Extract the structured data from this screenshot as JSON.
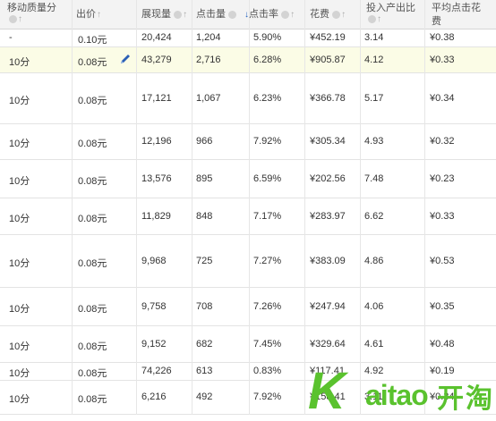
{
  "headers": {
    "quality": "移动质量分",
    "bid": "出价",
    "impressions": "展现量",
    "clicks": "点击量",
    "ctr": "点击率",
    "cost": "花费",
    "roi": "投入产出比",
    "avg_cpc_line1": "平均点击花",
    "avg_cpc_line2": "费"
  },
  "sort_indicators": {
    "up": "↑",
    "down": "↓",
    "active_column": "ctr"
  },
  "rows": [
    {
      "quality": "-",
      "bid": "0.10元",
      "impressions": "20,424",
      "clicks": "1,204",
      "ctr": "5.90%",
      "cost": "¥452.19",
      "roi": "3.14",
      "avg_cpc": "¥0.38"
    },
    {
      "quality": "10分",
      "bid": "0.08元",
      "impressions": "43,279",
      "clicks": "2,716",
      "ctr": "6.28%",
      "cost": "¥905.87",
      "roi": "4.12",
      "avg_cpc": "¥0.33"
    },
    {
      "quality": "10分",
      "bid": "0.08元",
      "impressions": "17,121",
      "clicks": "1,067",
      "ctr": "6.23%",
      "cost": "¥366.78",
      "roi": "5.17",
      "avg_cpc": "¥0.34"
    },
    {
      "quality": "10分",
      "bid": "0.08元",
      "impressions": "12,196",
      "clicks": "966",
      "ctr": "7.92%",
      "cost": "¥305.34",
      "roi": "4.93",
      "avg_cpc": "¥0.32"
    },
    {
      "quality": "10分",
      "bid": "0.08元",
      "impressions": "13,576",
      "clicks": "895",
      "ctr": "6.59%",
      "cost": "¥202.56",
      "roi": "7.48",
      "avg_cpc": "¥0.23"
    },
    {
      "quality": "10分",
      "bid": "0.08元",
      "impressions": "11,829",
      "clicks": "848",
      "ctr": "7.17%",
      "cost": "¥283.97",
      "roi": "6.62",
      "avg_cpc": "¥0.33"
    },
    {
      "quality": "10分",
      "bid": "0.08元",
      "impressions": "9,968",
      "clicks": "725",
      "ctr": "7.27%",
      "cost": "¥383.09",
      "roi": "4.86",
      "avg_cpc": "¥0.53"
    },
    {
      "quality": "10分",
      "bid": "0.08元",
      "impressions": "9,758",
      "clicks": "708",
      "ctr": "7.26%",
      "cost": "¥247.94",
      "roi": "4.06",
      "avg_cpc": "¥0.35"
    },
    {
      "quality": "10分",
      "bid": "0.08元",
      "impressions": "9,152",
      "clicks": "682",
      "ctr": "7.45%",
      "cost": "¥329.64",
      "roi": "4.61",
      "avg_cpc": "¥0.48"
    },
    {
      "quality": "10分",
      "bid": "0.08元",
      "impressions": "74,226",
      "clicks": "613",
      "ctr": "0.83%",
      "cost": "¥117.41",
      "roi": "4.92",
      "avg_cpc": "¥0.19"
    },
    {
      "quality": "10分",
      "bid": "0.08元",
      "impressions": "6,216",
      "clicks": "492",
      "ctr": "7.92%",
      "cost": "¥158.41",
      "roi": "3.11",
      "avg_cpc": "¥0.34"
    }
  ],
  "watermark": {
    "logo_latin_k": "K",
    "logo_latin_rest": "aitao",
    "logo_cn": "开淘",
    "color": "#5ac22e"
  },
  "colors": {
    "header_bg": "#f3f3f3",
    "highlight_row": "#fbfce6",
    "active_sort": "#1f5fbf",
    "edit_icon": "#2b5fb5"
  }
}
